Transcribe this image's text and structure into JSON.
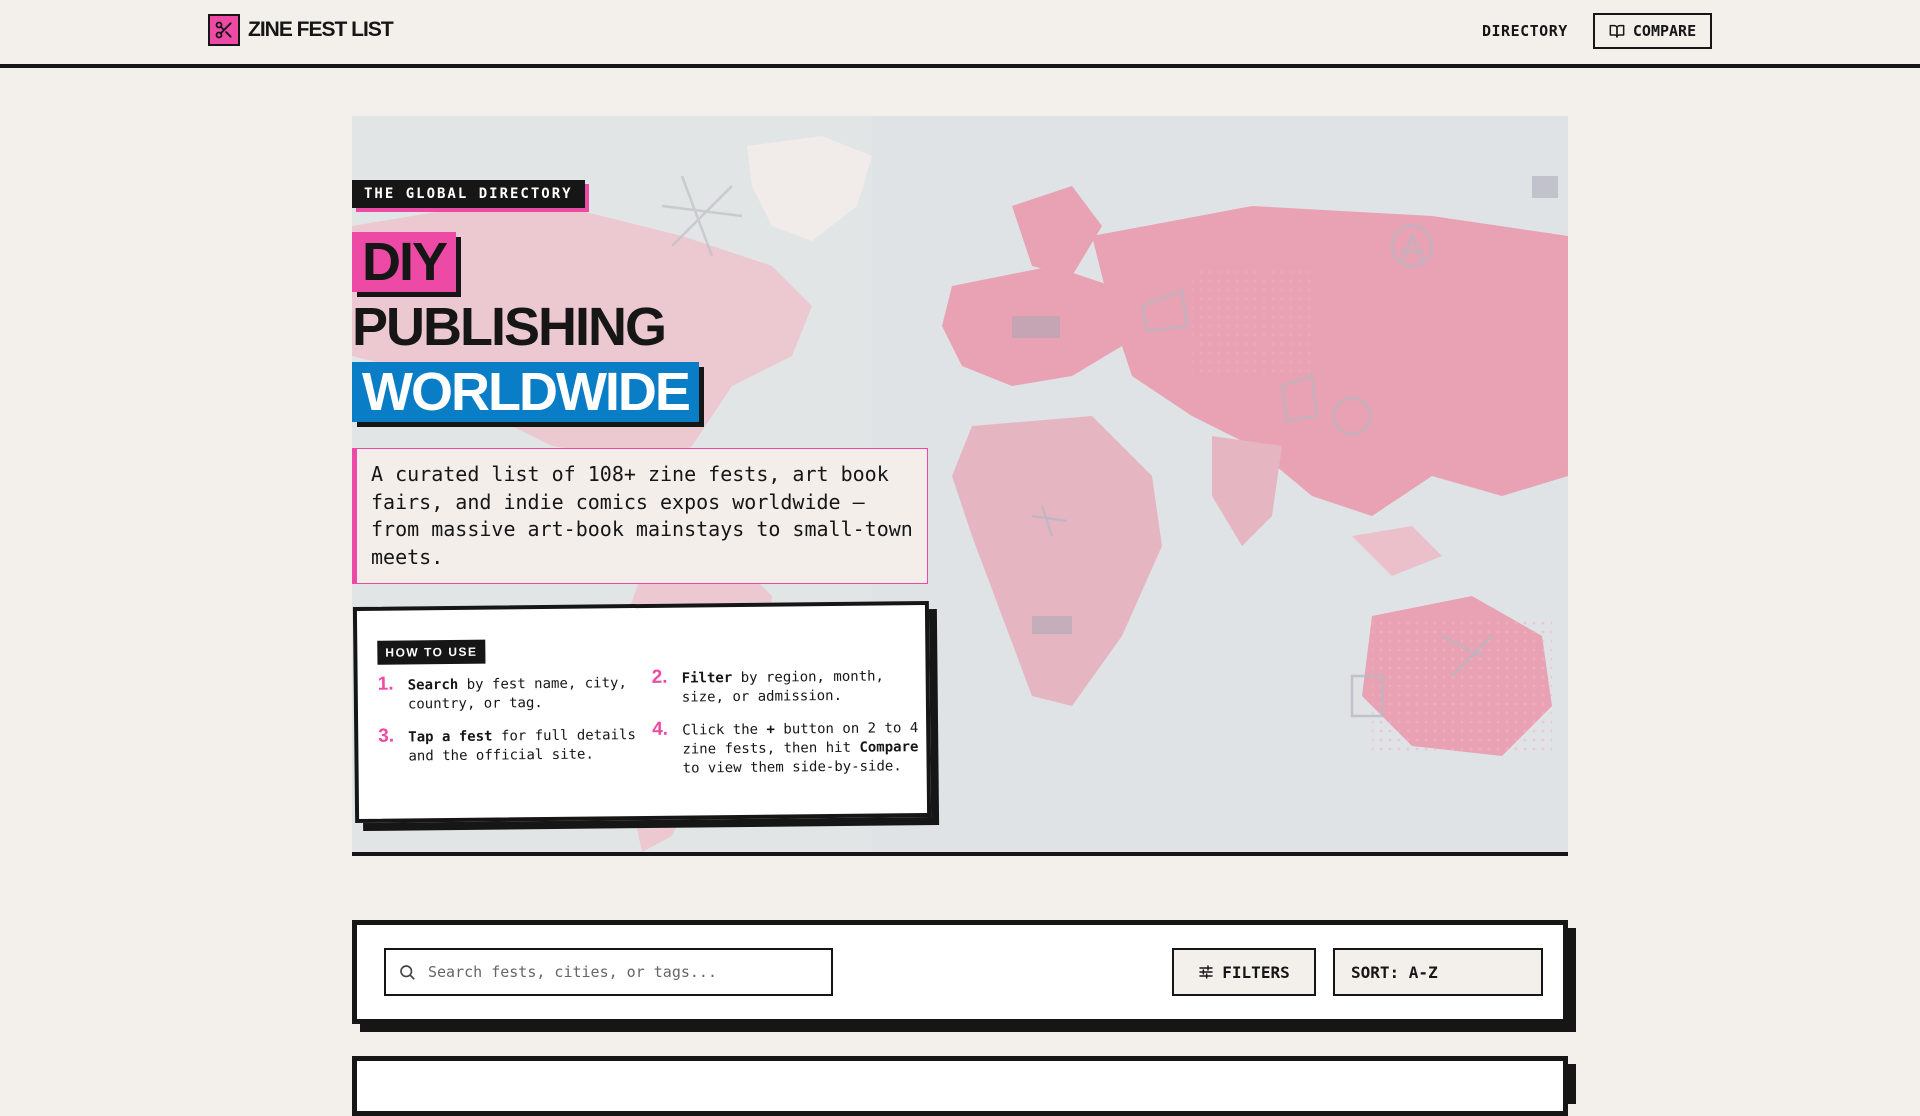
{
  "nav": {
    "brand": "ZINE FEST LIST",
    "directory": "DIRECTORY",
    "compare": "COMPARE"
  },
  "hero": {
    "eyebrow": "THE GLOBAL DIRECTORY",
    "headline": [
      "DIY",
      "PUBLISHING",
      "WORLDWIDE"
    ],
    "intro": "A curated list of 108+ zine fests, art book fairs, and indie comics expos worldwide — from massive art-book mainstays to small-town meets.",
    "howto": {
      "tag": "HOW TO USE",
      "steps": [
        {
          "num": "1.",
          "bold": "Search",
          "rest": " by fest name, city, country, or tag."
        },
        {
          "num": "2.",
          "bold": "Filter",
          "rest": " by region, month, size, or admission."
        },
        {
          "num": "3.",
          "bold": "Tap a fest",
          "rest": " for full details and the official site."
        },
        {
          "num": "4.",
          "pre": "Click the ",
          "plus": "+",
          "mid": " button on 2 to 4 zine fests, then hit ",
          "bold": "Compare",
          "rest": " to view them side-by-side."
        }
      ]
    }
  },
  "toolbar": {
    "search_placeholder": "Search fests, cities, or tags...",
    "filters": "FILTERS",
    "sort": "SORT: A-Z"
  },
  "colors": {
    "pink": "#ec4aa4",
    "blue": "#0a7dc7",
    "ink": "#161616",
    "paper": "#f3f0eb"
  }
}
